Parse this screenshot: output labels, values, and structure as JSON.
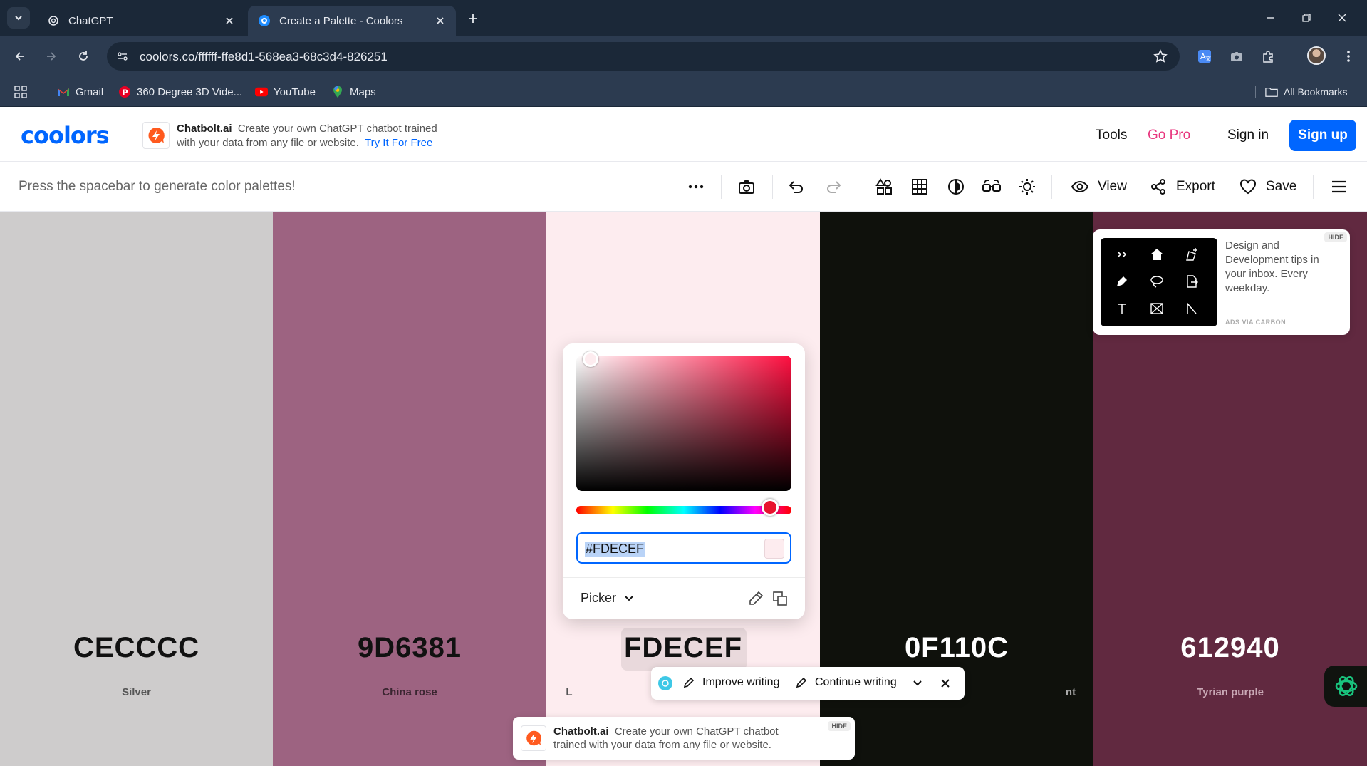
{
  "browser": {
    "tabs": [
      {
        "title": "ChatGPT",
        "icon": "openai-icon",
        "active": false
      },
      {
        "title": "Create a Palette - Coolors",
        "icon": "coolors-icon",
        "active": true
      }
    ],
    "url": "coolors.co/ffffff-ffe8d1-568ea3-68c3d4-826251",
    "bookmarks": [
      {
        "label": "Gmail",
        "icon": "gmail-icon"
      },
      {
        "label": "360 Degree 3D Vide...",
        "icon": "pinterest-icon"
      },
      {
        "label": "YouTube",
        "icon": "youtube-icon"
      },
      {
        "label": "Maps",
        "icon": "maps-icon"
      }
    ],
    "all_bookmarks": "All Bookmarks"
  },
  "header": {
    "logo": "coolors",
    "ad": {
      "brand": "Chatbolt.ai",
      "text_line1": "Create your own ChatGPT chatbot trained",
      "text_line2": "with your data from any file or website.",
      "cta": "Try It For Free"
    },
    "tools": "Tools",
    "go_pro": "Go Pro",
    "sign_in": "Sign in",
    "sign_up": "Sign up"
  },
  "palette_bar": {
    "hint": "Press the spacebar to generate color palettes!",
    "view": "View",
    "export": "Export",
    "save": "Save"
  },
  "palette": {
    "colors": [
      {
        "hex": "CECCCC",
        "name": "Silver",
        "bg": "#CECCCC",
        "fg": "#111111",
        "name_color": "#555555"
      },
      {
        "hex": "9D6381",
        "name": "China rose",
        "bg": "#9D6381",
        "fg": "#111111",
        "name_color": "#3a2530"
      },
      {
        "hex": "FDECEF",
        "name": "L",
        "bg": "#FDECEF",
        "fg": "#111111",
        "name_color": "#555555"
      },
      {
        "hex": "0F110C",
        "name": "nt",
        "bg": "#0F110C",
        "fg": "#ffffff",
        "name_color": "#aaaaaa"
      },
      {
        "hex": "612940",
        "name": "Tyrian purple",
        "bg": "#612940",
        "fg": "#ffffff",
        "name_color": "#c9a8b5"
      }
    ]
  },
  "picker": {
    "hex_value": "#FDECEF",
    "mode": "Picker"
  },
  "carbon_ad": {
    "text": "Design and Development tips in your inbox. Every weekday.",
    "via": "ADS VIA CARBON",
    "hide": "HIDE"
  },
  "writing_bar": {
    "improve": "Improve writing",
    "continue": "Continue writing"
  },
  "bottom_ad": {
    "brand": "Chatbolt.ai",
    "text": "Create your own ChatGPT chatbot trained with your data from any file or website.",
    "hide": "HIDE"
  }
}
